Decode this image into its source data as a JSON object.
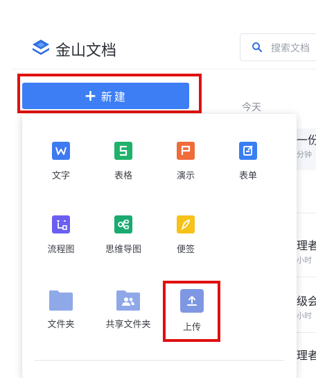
{
  "header": {
    "brand": "金山文档",
    "search_placeholder": "搜索文档"
  },
  "toolbar": {
    "new_plus": "+",
    "new_label": "新建"
  },
  "recent": {
    "today_label": "今天",
    "rows": [
      {
        "title": "一份",
        "sub": "分钟"
      },
      {
        "title": "理者",
        "sub": "小时"
      },
      {
        "title": "级会",
        "sub": "小时"
      },
      {
        "title": "理者",
        "sub": ""
      }
    ]
  },
  "new_menu": {
    "items": [
      {
        "label": "文字",
        "icon": "word-doc-icon",
        "color": "#3e7af0"
      },
      {
        "label": "表格",
        "icon": "spreadsheet-icon",
        "color": "#1fb26b"
      },
      {
        "label": "演示",
        "icon": "presentation-icon",
        "color": "#f06b3a"
      },
      {
        "label": "表单",
        "icon": "form-icon",
        "color": "#3a7ff2"
      },
      {
        "label": "流程图",
        "icon": "flowchart-icon",
        "color": "#6a5ff0"
      },
      {
        "label": "思维导图",
        "icon": "mindmap-icon",
        "color": "#1aaa72"
      },
      {
        "label": "便签",
        "icon": "note-icon",
        "color": "#f6c21a"
      },
      {
        "label": "文件夹",
        "icon": "folder-icon",
        "color": "#8fa8e8"
      },
      {
        "label": "共享文件夹",
        "icon": "shared-folder-icon",
        "color": "#8fa8e8"
      },
      {
        "label": "上传",
        "icon": "upload-icon",
        "color": "#7f97e3"
      }
    ]
  }
}
